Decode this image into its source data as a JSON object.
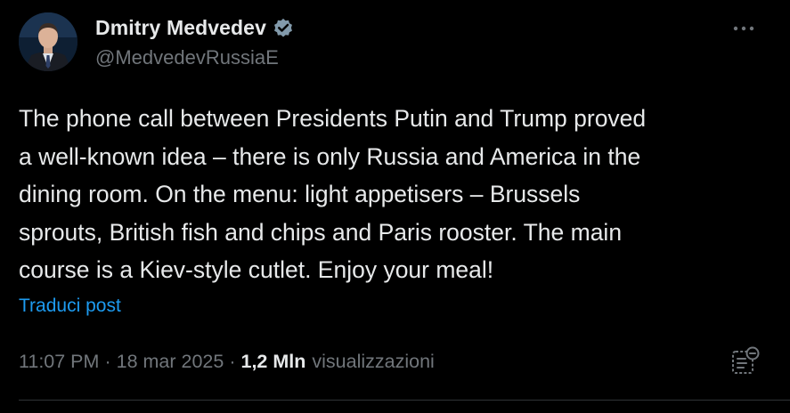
{
  "author": {
    "display_name": "Dmitry Medvedev",
    "handle": "@MedvedevRussiaE",
    "verified_icon": "verified-badge-icon",
    "avatar": "profile-photo"
  },
  "post": {
    "text": "The phone call between Presidents Putin and Trump proved\na well-known idea – there is only Russia and America in the\ndining room. On the menu: light appetisers – Brussels\nsprouts, British fish and chips and Paris rooster. The main\ncourse is a Kiev-style cutlet. Enjoy your meal!",
    "translate_label": "Traduci post"
  },
  "meta": {
    "time": "11:07 PM",
    "separator": "·",
    "date": "18 mar 2025",
    "views_count": "1,2 Mln",
    "views_label": "visualizzazioni"
  },
  "icons": {
    "more": "more-options-icon",
    "analytics": "post-analytics-icon"
  },
  "colors": {
    "background": "#000000",
    "primary_text": "#e7e9ea",
    "secondary_text": "#71767b",
    "link": "#1d9bf0",
    "divider": "#2f3336"
  }
}
